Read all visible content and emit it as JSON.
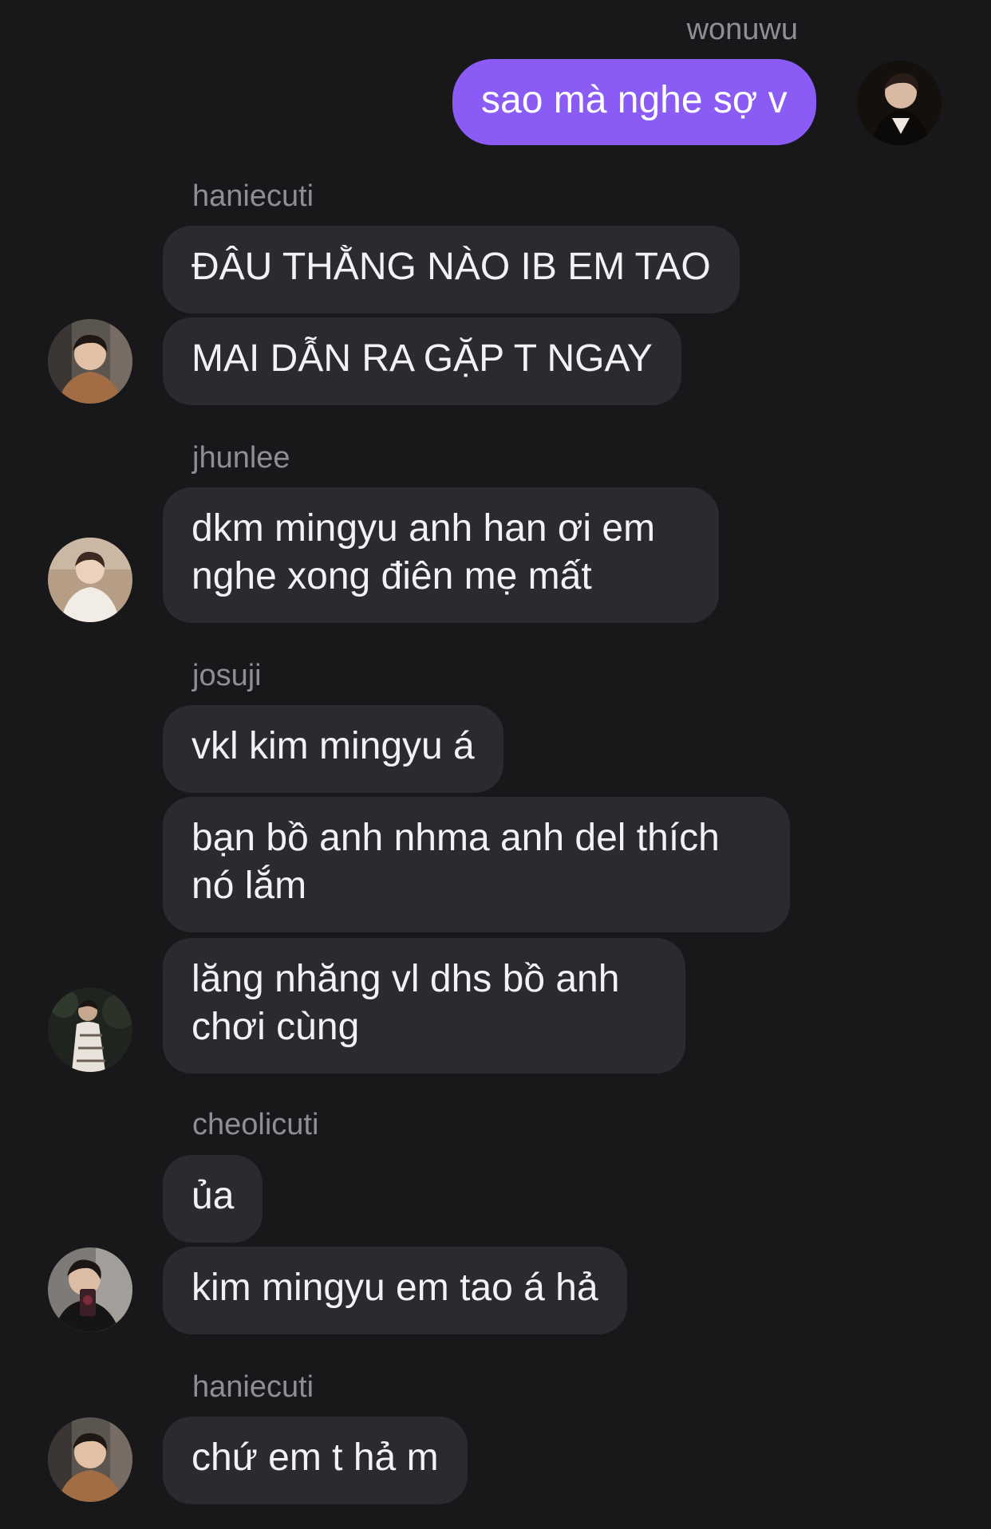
{
  "messages": {
    "m1": {
      "sender": "wonuwu",
      "text": "sao mà nghe sợ v"
    },
    "m2": {
      "sender": "haniecuti",
      "text1": "ĐÂU THẰNG NÀO IB EM TAO",
      "text2": "MAI DẪN RA GẶP T NGAY"
    },
    "m3": {
      "sender": "jhunlee",
      "line1": "dkm mingyu anh han ơi em",
      "line2": "nghe xong điên mẹ mất"
    },
    "m4": {
      "sender": "josuji",
      "text1": "vkl kim mingyu á",
      "b2_line1": "bạn bồ anh nhma anh del thích",
      "b2_line2": "nó lắm",
      "b3_line1": "lăng nhăng vl dhs bồ anh",
      "b3_line2": "chơi cùng"
    },
    "m5": {
      "sender": "cheolicuti",
      "text1": "ủa",
      "text2": "kim mingyu em tao á hả"
    },
    "m6": {
      "sender": "haniecuti",
      "text": "chứ em t hả m"
    }
  },
  "colors": {
    "background": "#18181b",
    "bubble": "#2b2b2f",
    "own_bubble": "#8a5cf5",
    "username": "#8e8e93"
  },
  "icons": {
    "avatar": "profile-photo"
  }
}
